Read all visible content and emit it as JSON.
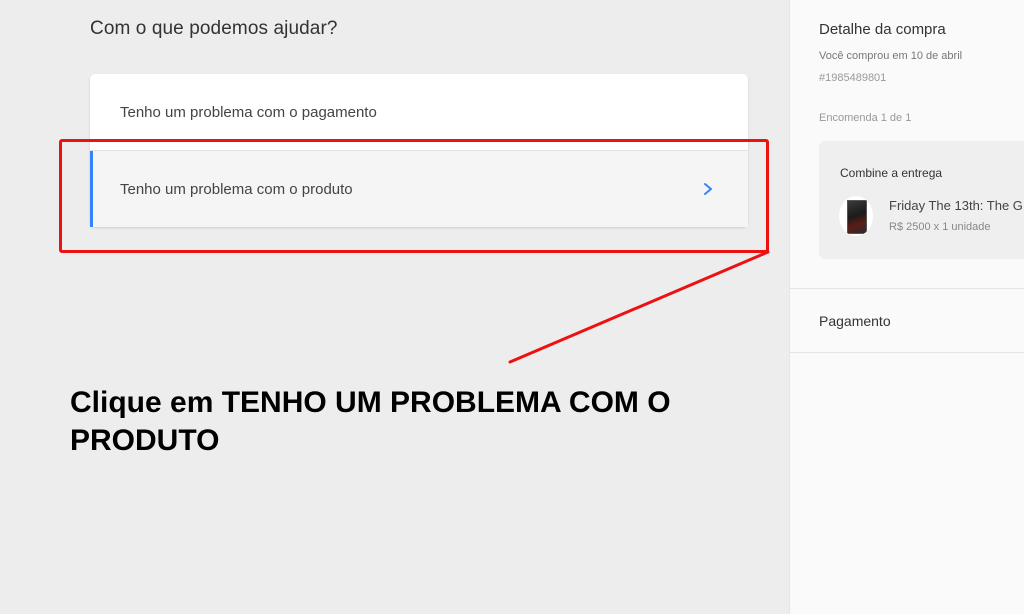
{
  "main": {
    "title": "Com o que podemos ajudar?",
    "options": [
      {
        "label": "Tenho um problema com o pagamento"
      },
      {
        "label": "Tenho um problema com o produto",
        "selected": true
      }
    ]
  },
  "instruction": "Clique em TENHO UM PROBLEMA COM O PRODUTO",
  "sidebar": {
    "title": "Detalhe da compra",
    "purchase_date": "Você comprou em 10 de abril",
    "order_id": "#1985489801",
    "package": "Encomenda 1 de 1",
    "shipping": {
      "title": "Combine a entrega",
      "product_name": "Friday The 13th: The G",
      "product_price": "R$ 2500 x 1 unidade"
    },
    "payment_title": "Pagamento"
  },
  "colors": {
    "accent": "#3483fa",
    "highlight": "#e11111",
    "background": "#ededed"
  },
  "icons": {
    "chevron": "chevron-right-icon"
  }
}
